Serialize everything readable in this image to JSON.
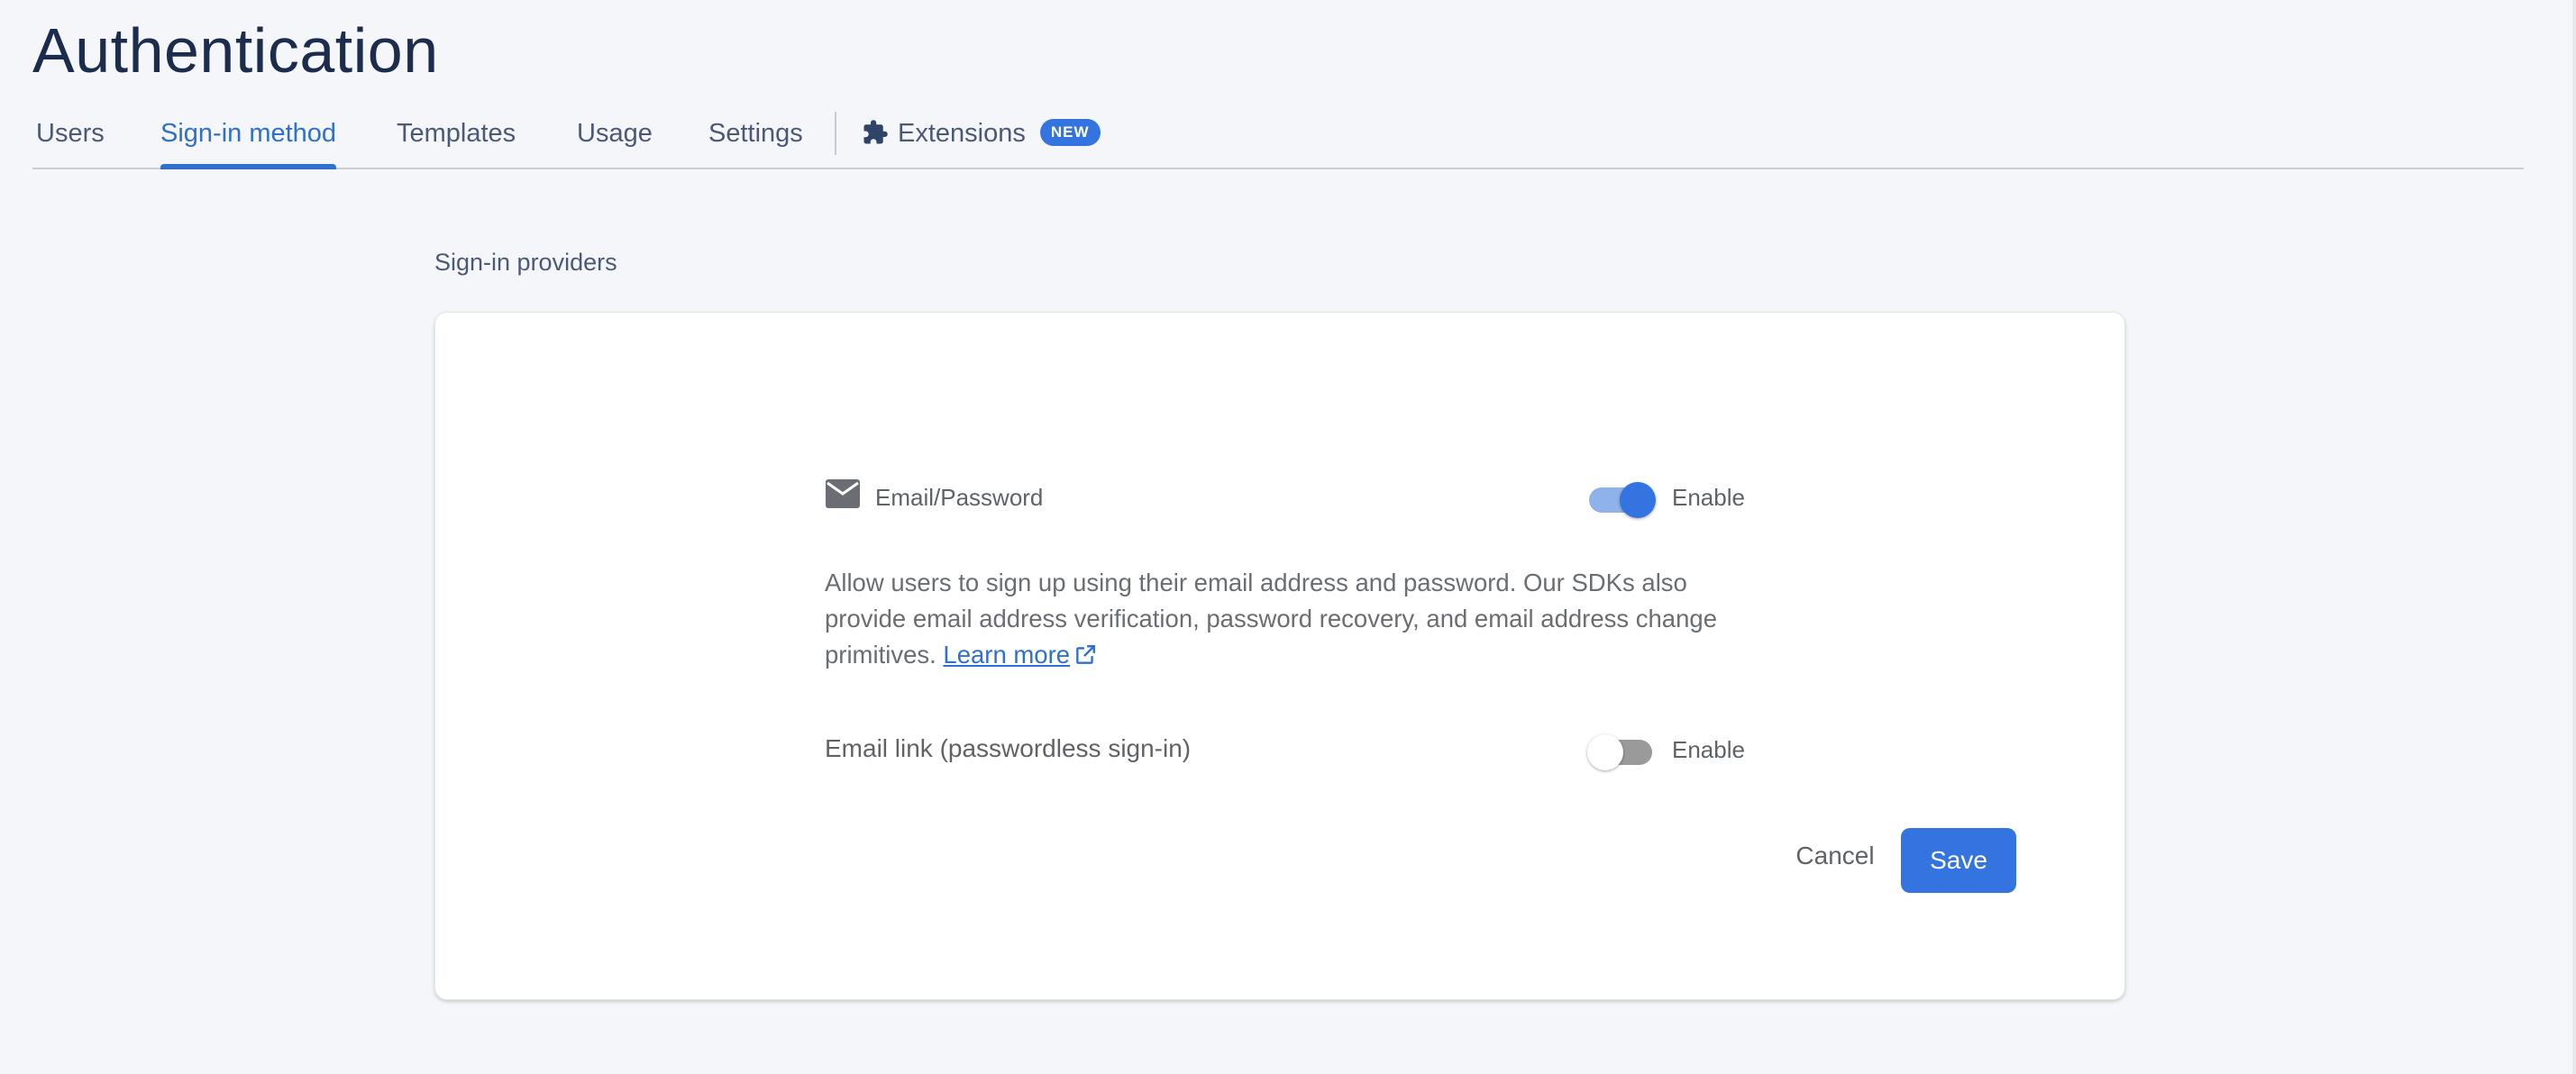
{
  "page": {
    "title": "Authentication"
  },
  "tabs": [
    {
      "label": "Users",
      "active": false
    },
    {
      "label": "Sign-in method",
      "active": true
    },
    {
      "label": "Templates",
      "active": false
    },
    {
      "label": "Usage",
      "active": false
    },
    {
      "label": "Settings",
      "active": false
    }
  ],
  "extensions_tab": {
    "label": "Extensions",
    "badge": "NEW",
    "icon": "puzzle-icon"
  },
  "section": {
    "label": "Sign-in providers"
  },
  "provider": {
    "name": "Email/Password",
    "icon": "mail-icon",
    "enable_label": "Enable",
    "enabled": true,
    "description": "Allow users to sign up using their email address and password. Our SDKs also provide email address verification, password recovery, and email address change primitives.",
    "learn_more": "Learn more"
  },
  "email_link": {
    "name": "Email link (passwordless sign-in)",
    "enable_label": "Enable",
    "enabled": false
  },
  "actions": {
    "cancel": "Cancel",
    "save": "Save"
  },
  "colors": {
    "accent": "#3474e0",
    "title": "#1c2c4c",
    "background": "#f4f6f9"
  }
}
